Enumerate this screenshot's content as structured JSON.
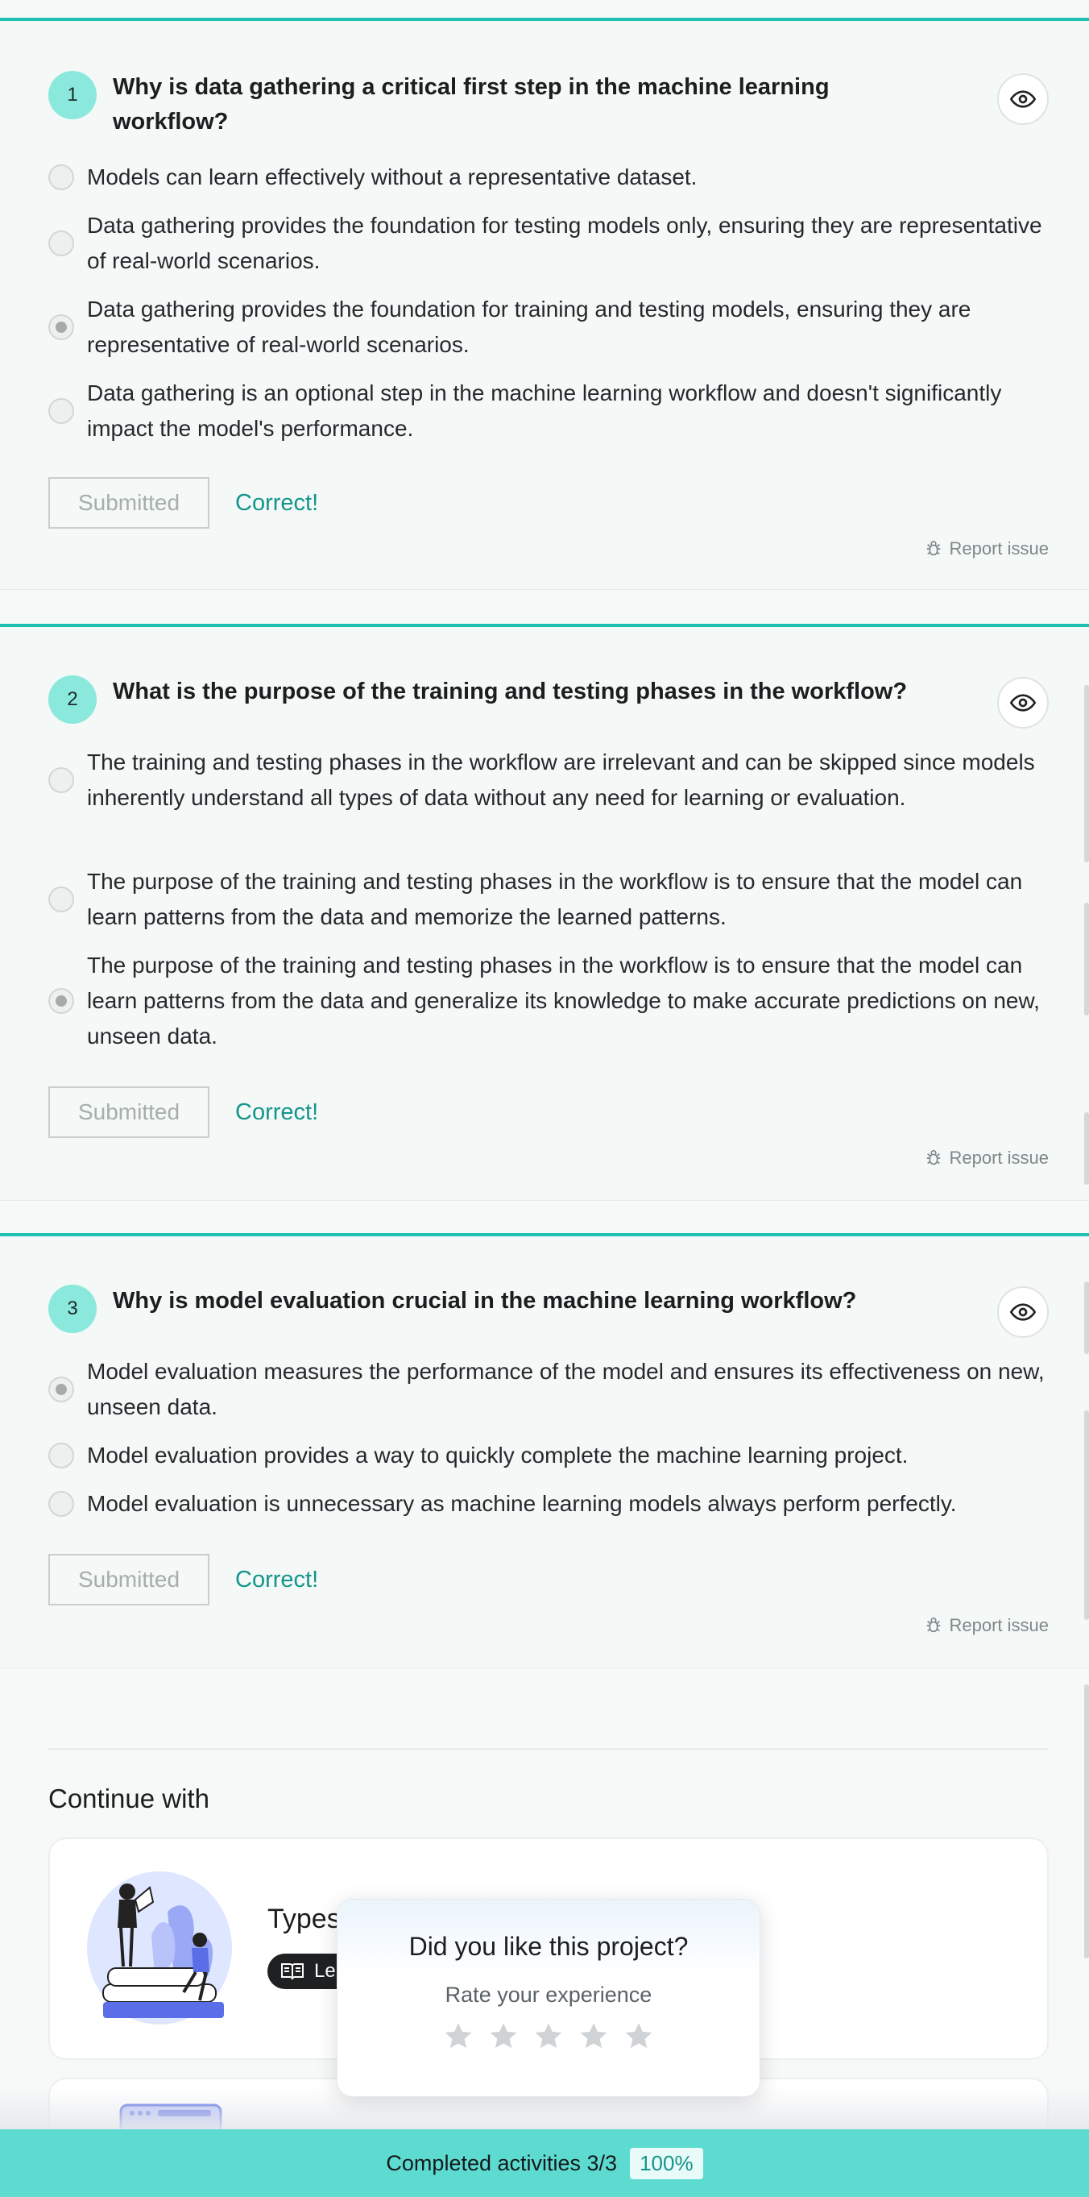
{
  "questions": [
    {
      "number": "1",
      "text": "Why is data gathering a critical first step in the machine learning workflow?",
      "options": [
        {
          "text": "Models can learn effectively without a representative dataset.",
          "selected": false
        },
        {
          "text": "Data gathering provides the foundation for testing models only, ensuring they are representative of real-world scenarios.",
          "selected": false
        },
        {
          "text": "Data gathering provides the foundation for training and testing models, ensuring they are representative of real-world scenarios.",
          "selected": true
        },
        {
          "text": "Data gathering is an optional step in the machine learning workflow and doesn't significantly impact the model's performance.",
          "selected": false
        }
      ],
      "submit_label": "Submitted",
      "result": "Correct!",
      "report_label": "Report issue"
    },
    {
      "number": "2",
      "text": "What is the purpose of the training and testing phases in the workflow?",
      "options": [
        {
          "text": "The training and testing phases in the workflow are irrelevant and can be skipped since models inherently understand all types of data without any need for learning or evaluation.",
          "selected": false
        },
        {
          "text": "The purpose of the training and testing phases in the workflow is to ensure that the model can learn patterns from the data and memorize the learned patterns.",
          "selected": false
        },
        {
          "text": "The purpose of the training and testing phases in the workflow is to ensure that the model can learn patterns from the data and generalize its knowledge to make accurate predictions on new, unseen data.",
          "selected": true
        }
      ],
      "submit_label": "Submitted",
      "result": "Correct!",
      "report_label": "Report issue"
    },
    {
      "number": "3",
      "text": "Why is model evaluation crucial in the machine learning workflow?",
      "options": [
        {
          "text": "Model evaluation measures the performance of the model and ensures its effectiveness on new, unseen data.",
          "selected": true
        },
        {
          "text": "Model evaluation provides a way to quickly complete the machine learning project.",
          "selected": false
        },
        {
          "text": "Model evaluation is unnecessary as machine learning models always perform perfectly.",
          "selected": false
        }
      ],
      "submit_label": "Submitted",
      "result": "Correct!",
      "report_label": "Report issue"
    }
  ],
  "continue": {
    "title": "Continue with",
    "course": {
      "title": "Types",
      "badge": "Le"
    }
  },
  "rating_popup": {
    "title": "Did you like this project?",
    "subtitle": "Rate your experience",
    "stars": 5,
    "rating": 0
  },
  "progress_bar": {
    "label": "Completed activities 3/3",
    "percent_label": "100%",
    "progress": 1.0
  },
  "colors": {
    "accent": "#1fc1b3",
    "correct": "#14958c",
    "bottom_bar": "#5ddbd0",
    "number_badge": "#8be8dc"
  }
}
